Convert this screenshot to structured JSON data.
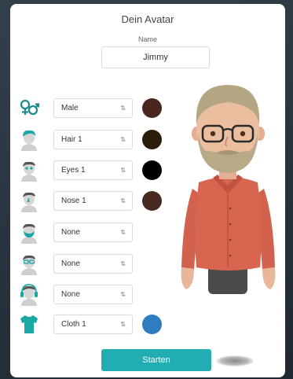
{
  "panel": {
    "title": "Dein Avatar"
  },
  "name": {
    "label": "Name",
    "value": "Jimmy"
  },
  "rows": [
    {
      "icon": "gender-icon",
      "value": "Male",
      "color": "#4a261e"
    },
    {
      "icon": "hair-icon",
      "value": "Hair 1",
      "color": "#2c1d0b"
    },
    {
      "icon": "eyes-icon",
      "value": "Eyes 1",
      "color": "#000000"
    },
    {
      "icon": "nose-icon",
      "value": "Nose 1",
      "color": "#472a1f"
    },
    {
      "icon": "beard-icon",
      "value": "None",
      "color": null
    },
    {
      "icon": "glasses-icon",
      "value": "None",
      "color": null
    },
    {
      "icon": "headphones-icon",
      "value": "None",
      "color": null
    },
    {
      "icon": "shirt-icon",
      "value": "Cloth 1",
      "color": "#2d7dc0"
    }
  ],
  "accent_color": "#22adb2",
  "start_button": {
    "label": "Starten"
  }
}
